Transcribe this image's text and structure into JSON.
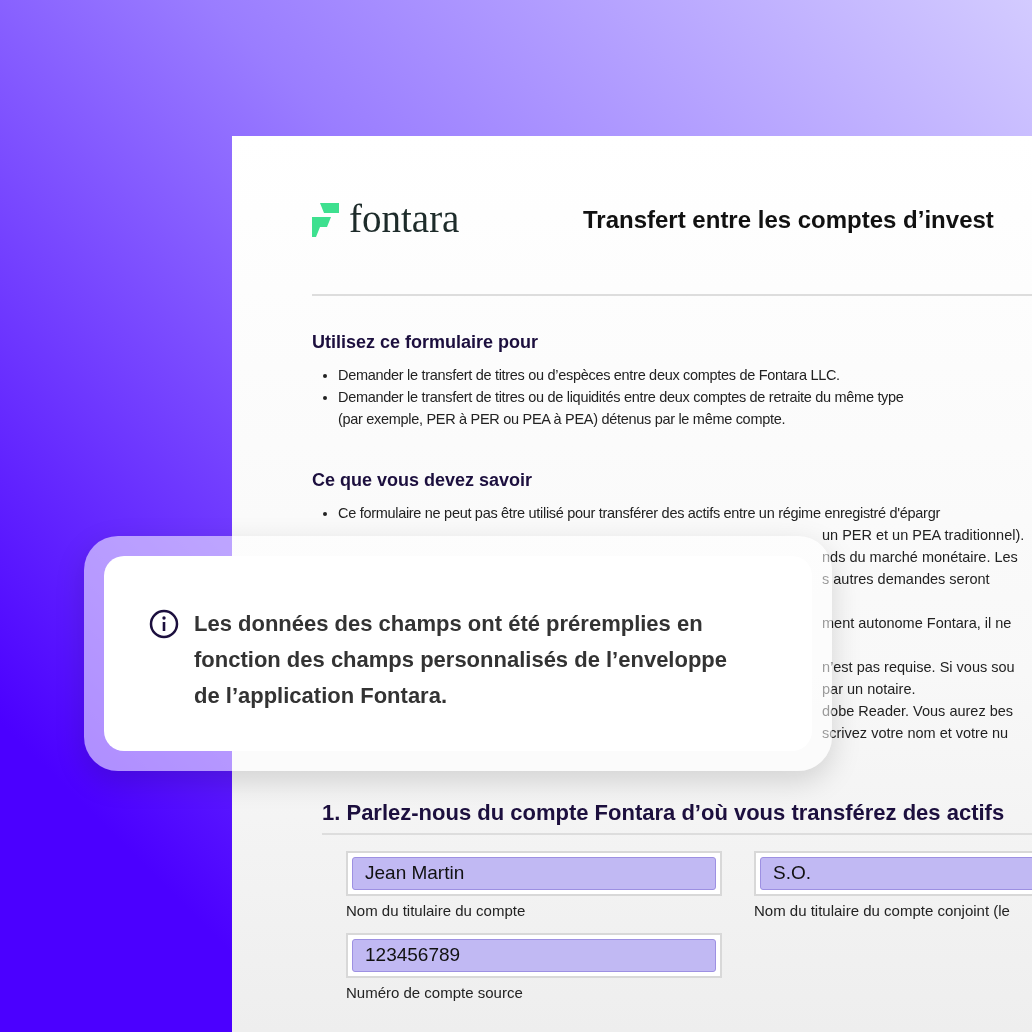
{
  "document": {
    "logo": {
      "name": "fontara"
    },
    "title": "Transfert entre les comptes d’invest",
    "sections": [
      {
        "heading": "Utilisez ce formulaire pour",
        "bullets": [
          [
            "Demander le transfert de titres ou d’espèces entre deux comptes de Fontara LLC."
          ],
          [
            "Demander le transfert de titres ou de liquidités entre deux comptes de retraite du même type",
            "(par exemple, PER à PER ou PEA à PEA) détenus par le même compte."
          ]
        ]
      },
      {
        "heading": "Ce que vous devez savoir",
        "bullets": [
          [
            "Ce formulaire ne peut pas être utilisé pour transférer des actifs entre un régime enregistré d'épargr"
          ]
        ],
        "covered_fragments": [
          [
            "un PER et un PEA traditionnel).",
            "nds du marché monétaire. Les",
            "s autres demandes seront"
          ],
          [
            "ment autonome Fontara, il ne"
          ],
          [
            "n’est pas requise. Si vous sou",
            "par un notaire.",
            "dobe Reader. Vous aurez bes",
            "scrivez votre nom et votre nu"
          ]
        ]
      }
    ],
    "form_section": {
      "heading": "1. Parlez-nous du compte Fontara d’où vous transférez des actifs",
      "fields": [
        {
          "value": "Jean Martin",
          "label": "Nom du titulaire du compte",
          "prefilled": true
        },
        {
          "value": "S.O.",
          "label": "Nom du titulaire du compte conjoint (le",
          "prefilled": true
        },
        {
          "value": "123456789",
          "label": "Numéro de compte source",
          "prefilled": true
        }
      ]
    }
  },
  "notice": {
    "text": "Les données des champs ont été préremplies en fonction des champs personnalisés de l’enveloppe de l’application Fontara."
  }
}
